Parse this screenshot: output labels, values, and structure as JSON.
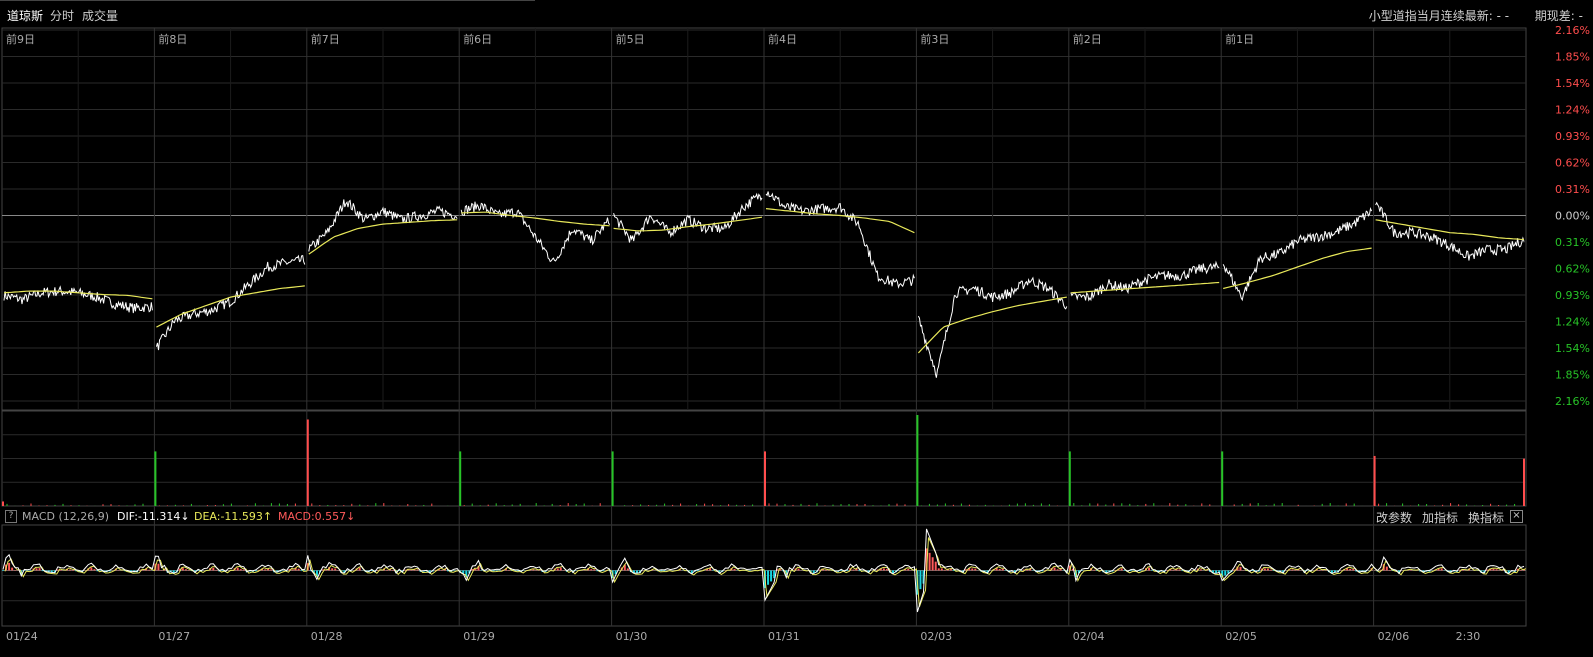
{
  "header": {
    "symbol_name": "道琼斯",
    "tabs": [
      {
        "label": "分时",
        "active": true
      },
      {
        "label": "成交量",
        "active": false
      }
    ],
    "mini_index_text": "小型道指当月连续最新: - -",
    "basis_text": "期现差: -"
  },
  "price_axis": {
    "labels": [
      "2.16%",
      "1.85%",
      "1.54%",
      "1.24%",
      "0.93%",
      "0.62%",
      "0.31%",
      "0.00%",
      "0.31%",
      "0.62%",
      "0.93%",
      "1.24%",
      "1.54%",
      "1.85%",
      "2.16%"
    ],
    "up_color": "#ff4d4d",
    "down_color": "#27c427",
    "zero_color": "#cccccc"
  },
  "day_labels": [
    "前9日",
    "前8日",
    "前7日",
    "前6日",
    "前5日",
    "前4日",
    "前3日",
    "前2日",
    "前1日"
  ],
  "date_labels": [
    "01/24",
    "01/27",
    "01/28",
    "01/29",
    "01/30",
    "01/31",
    "02/03",
    "02/04",
    "02/05",
    "02/06",
    "2:30"
  ],
  "macd": {
    "name": "MACD",
    "params": "(12,26,9)",
    "dif_label": "DIF:-11.314↓",
    "dea_label": "DEA:-11.593↑",
    "macd_label": "MACD:0.557↓",
    "dif_color": "#ffffff",
    "dea_color": "#e8e85a",
    "macd_color": "#ff5a5a",
    "buttons": [
      "改参数",
      "加指标",
      "换指标"
    ],
    "help_label": "?",
    "close_label": "×"
  },
  "chart_data": {
    "type": "line",
    "x_axis": "trading days (10 sessions, intraday)",
    "y_unit": "% change vs. previous close",
    "ylim": [
      -2.16,
      2.16
    ],
    "series": [
      {
        "name": "price",
        "color": "#ffffff",
        "day_points": [
          [
            -0.93,
            -0.98,
            -0.9,
            -0.88,
            -0.9,
            -0.95,
            -1.03,
            -1.08,
            -1.06
          ],
          [
            -1.55,
            -1.22,
            -1.15,
            -1.1,
            -1.0,
            -0.8,
            -0.6,
            -0.55,
            -0.52
          ],
          [
            -0.4,
            -0.2,
            0.18,
            -0.05,
            0.05,
            -0.05,
            0.0,
            0.05,
            0.0
          ],
          [
            0.05,
            0.12,
            0.0,
            0.05,
            -0.25,
            -0.55,
            -0.15,
            -0.3,
            -0.05
          ],
          [
            0.0,
            -0.3,
            0.0,
            -0.2,
            -0.05,
            -0.15,
            -0.15,
            0.1,
            0.25
          ],
          [
            0.3,
            0.1,
            0.05,
            0.08,
            0.1,
            -0.1,
            -0.7,
            -0.8,
            -0.75
          ],
          [
            -1.2,
            -1.85,
            -0.9,
            -0.85,
            -0.95,
            -0.9,
            -0.75,
            -0.85,
            -1.05
          ],
          [
            -0.95,
            -0.95,
            -0.8,
            -0.85,
            -0.75,
            -0.7,
            -0.7,
            -0.62,
            -0.6
          ],
          [
            -0.55,
            -0.95,
            -0.5,
            -0.45,
            -0.3,
            -0.25,
            -0.2,
            -0.1,
            0.05
          ],
          [
            0.15,
            -0.2,
            -0.2,
            -0.25,
            -0.35,
            -0.48,
            -0.4,
            -0.4,
            -0.28
          ]
        ]
      },
      {
        "name": "average",
        "color": "#e8e85a",
        "day_points": [
          [
            -0.9,
            -0.88,
            -0.88,
            -0.9,
            -0.92,
            -0.93,
            -0.97
          ],
          [
            -1.3,
            -1.15,
            -1.05,
            -0.95,
            -0.9,
            -0.85,
            -0.82
          ],
          [
            -0.45,
            -0.25,
            -0.15,
            -0.1,
            -0.08,
            -0.06,
            -0.05
          ],
          [
            0.03,
            0.04,
            0.0,
            -0.03,
            -0.07,
            -0.1,
            -0.12
          ],
          [
            -0.15,
            -0.18,
            -0.17,
            -0.13,
            -0.1,
            -0.06,
            -0.02
          ],
          [
            0.08,
            0.05,
            0.02,
            0.0,
            -0.03,
            -0.07,
            -0.2
          ],
          [
            -1.6,
            -1.3,
            -1.2,
            -1.12,
            -1.05,
            -1.0,
            -0.95
          ],
          [
            -0.9,
            -0.88,
            -0.86,
            -0.84,
            -0.82,
            -0.8,
            -0.78
          ],
          [
            -0.85,
            -0.78,
            -0.7,
            -0.6,
            -0.5,
            -0.42,
            -0.38
          ],
          [
            -0.05,
            -0.1,
            -0.15,
            -0.2,
            -0.22,
            -0.26,
            -0.28
          ]
        ]
      }
    ],
    "volume": {
      "open_spike_heights": [
        0.05,
        0.6,
        0.95,
        0.6,
        0.6,
        0.6,
        1.0,
        0.6,
        0.6,
        0.55,
        0.52
      ],
      "spike_colors": [
        "red",
        "green",
        "red",
        "green",
        "green",
        "red",
        "green",
        "green",
        "green",
        "red",
        "red"
      ]
    }
  }
}
